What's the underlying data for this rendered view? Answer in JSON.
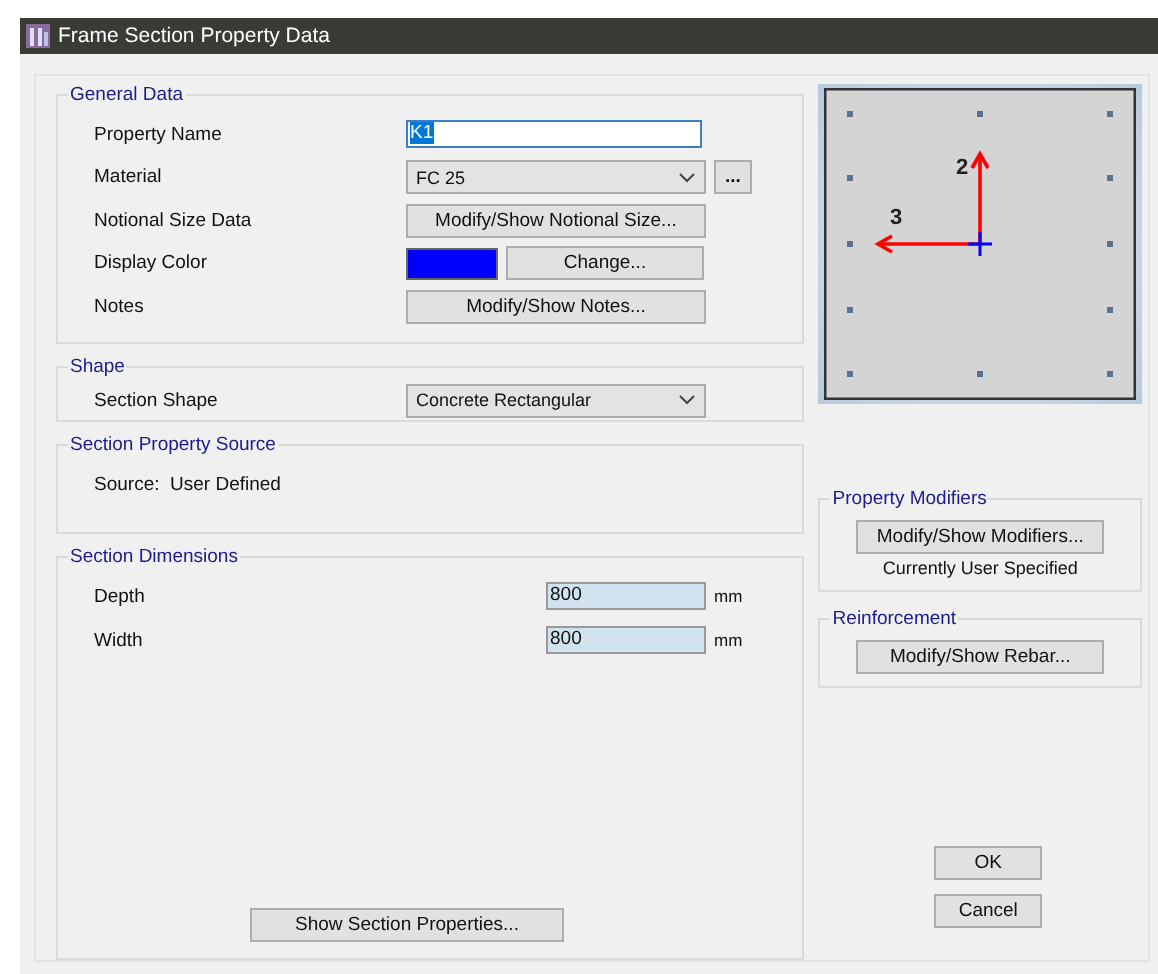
{
  "window": {
    "title": "Frame Section Property Data"
  },
  "general_data": {
    "title": "General Data",
    "property_name": {
      "label": "Property Name",
      "value": "K1",
      "text_selected": true
    },
    "material": {
      "label": "Material",
      "value": "FC 25",
      "more_button": "..."
    },
    "notional_size": {
      "label": "Notional Size Data",
      "button": "Modify/Show Notional Size..."
    },
    "display_color": {
      "label": "Display Color",
      "color": "#0000ff",
      "button": "Change..."
    },
    "notes": {
      "label": "Notes",
      "button": "Modify/Show Notes..."
    }
  },
  "shape": {
    "title": "Shape",
    "label": "Section Shape",
    "value": "Concrete Rectangular"
  },
  "section_property_source": {
    "title": "Section Property Source",
    "text": "Source:  User Defined"
  },
  "section_dimensions": {
    "title": "Section Dimensions",
    "fields": [
      {
        "label": "Depth",
        "value": "800",
        "unit": "mm"
      },
      {
        "label": "Width",
        "value": "800",
        "unit": "mm"
      }
    ],
    "button": "Show Section Properties..."
  },
  "preview": {
    "axis_2": "2",
    "axis_3": "3"
  },
  "property_modifiers": {
    "title": "Property Modifiers",
    "button": "Modify/Show Modifiers...",
    "status": "Currently User Specified"
  },
  "reinforcement": {
    "title": "Reinforcement",
    "button": "Modify/Show Rebar..."
  },
  "buttons": [
    "OK",
    "Cancel"
  ]
}
